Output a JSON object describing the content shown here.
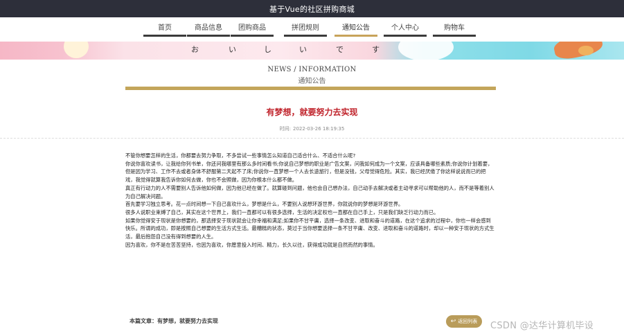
{
  "header": {
    "title": "基于Vue的社区拼购商城"
  },
  "nav": {
    "items": [
      "首页",
      "商品信息",
      "团购商品",
      "拼团规则",
      "通知公告",
      "个人中心",
      "购物车"
    ],
    "active": "通知公告"
  },
  "banner": {
    "text": [
      "お",
      "い",
      "し",
      "い",
      "で",
      "す"
    ]
  },
  "section": {
    "title_en": "NEWS / INFORMATION",
    "title_cn": "通知公告"
  },
  "article": {
    "title": "有梦想，就要努力去实现",
    "time_label": "时间:",
    "time_value": "2022-03-26 18:19:35",
    "paragraphs": [
      "不管你想要怎样的生活，你都要去努力争取，不多尝试一些事情怎么知道自己适合什么、不适合什么呢?",
      "你说你喜欢读书，让我给你列书单，你还问我哪里有那么多时间看书;你说自己梦想的职业是广告文案，问我如何成为一个文案，应该具备哪些素质;你说你计划着要，但是因为学习、工作不去或者身体不舒服第二天起不了床;你说你一直梦想一个人去长途旅行，但是没钱，父母觉得危险。其实，我已经厌倦了你这样说说而已的把戏，我觉得就算我告诉你如何去做，你也不会照做，因为你根本什么都不做。",
      "真正有行动力的人不需要别人告诉他如何做，因为他已经在做了。就算碰到问题，他也会自己想办法，自己动手去解决或者主动寻求可以帮助他的人，而不是等着别人为自己解决问题。",
      "首先要学习独立思考。花一点时间想一下自己喜欢什么，梦想是什么，不要别人说想环游世界，你就说你的梦想是环游世界。",
      "很多人说职业束缚了自己，其实在这个世界上，我们一直都可以有很多选择，生活的决定权也一直都在自己手上，只是我们缺乏行动力而已。",
      "如果你觉得安于现状是你想要的，那选择安于现状就会让你幸福和满足;如果你不甘平庸，选择一条改变、进取和奋斗的道路，在这个追求的过程中，你也一样会感到快乐。所谓的成功，即是按照自己想要的生活方式生活。最糟糕的状态，莫过于当你想要选择一条不甘平庸、改变、进取和奋斗的道路时，却以一种安于现状的方式生活，最后抱怨自己没有得到想要的人生。",
      "因为喜欢，你不是在苦苦坚持，也因为喜欢，你愿意投入时间、精力，长久以往，获得成功就是自然而然的事情。"
    ]
  },
  "footer": {
    "current_label": "本篇文章：",
    "current_title": "有梦想，就要努力去实现",
    "back_label": "返回列表",
    "watermark": "CSDN @达华计算机毕设"
  },
  "colors": {
    "accent_gold": "#c3a55a",
    "title_red": "#c0242c",
    "topbar": "#2d2f3a"
  }
}
